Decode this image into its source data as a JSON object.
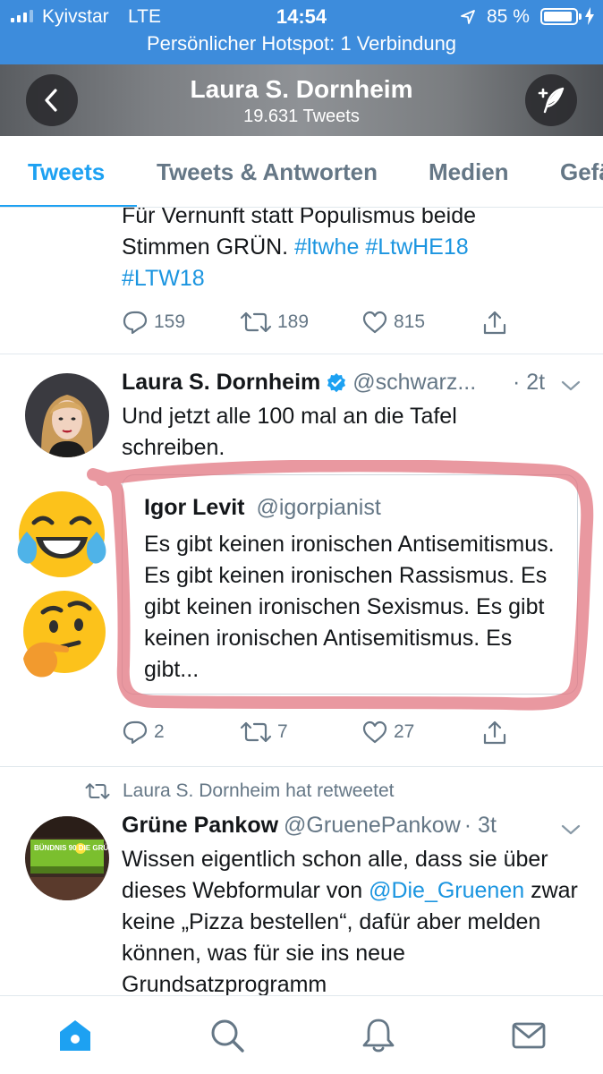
{
  "status_bar": {
    "carrier": "Kyivstar",
    "network": "LTE",
    "time": "14:54",
    "battery_percent": "85 %",
    "hotspot": "Persönlicher Hotspot: 1 Verbindung"
  },
  "header": {
    "name": "Laura S. Dornheim",
    "tweet_count": "19.631 Tweets"
  },
  "tabs": [
    {
      "label": "Tweets",
      "active": true
    },
    {
      "label": "Tweets & Antworten",
      "active": false
    },
    {
      "label": "Medien",
      "active": false
    },
    {
      "label": "Gefä",
      "active": false
    }
  ],
  "tweets": [
    {
      "text_line1": "Für Vernunft statt Populismus beide",
      "text_line2_plain": "Stimmen GRÜN. ",
      "hashtags_line2": [
        "#ltwhe",
        "#LtwHE18"
      ],
      "hashtags_line3": [
        "#LTW18"
      ],
      "replies": "159",
      "retweets": "189",
      "likes": "815"
    },
    {
      "name": "Laura S. Dornheim",
      "handle": "@schwarz...",
      "time": "· 2t",
      "text": "Und jetzt alle 100 mal an die Tafel schreiben.",
      "quote": {
        "name": "Igor Levit",
        "handle": "@igorpianist",
        "text": "Es gibt keinen ironischen Antisemitismus. Es gibt keinen ironischen Rassismus. Es gibt keinen ironischen Sexismus. Es gibt keinen ironischen Antisemitismus. Es gibt..."
      },
      "replies": "2",
      "retweets": "7",
      "likes": "27"
    },
    {
      "retweeted_by": "Laura S. Dornheim hat retweetet",
      "name": "Grüne Pankow",
      "handle": "@GruenePankow",
      "time": "· 3t",
      "text_before": "Wissen eigentlich schon alle, dass sie über dieses Webformular von ",
      "mention": "@Die_Gruenen",
      "text_after": " zwar keine „Pizza bestellen“, dafür aber melden können, was für sie ins neue Grundsatzprogramm",
      "avatar_text": "BÜNDNIS 90 DIE GRÜNEN"
    }
  ],
  "emojis": [
    "face-with-tears-of-joy",
    "thinking-face"
  ],
  "tabbar": [
    "home",
    "search",
    "notifications",
    "messages"
  ],
  "colors": {
    "accent": "#1da1f2",
    "status_bar": "#3d8cdc",
    "highlight_marker": "#e0707c",
    "muted": "#657786"
  }
}
